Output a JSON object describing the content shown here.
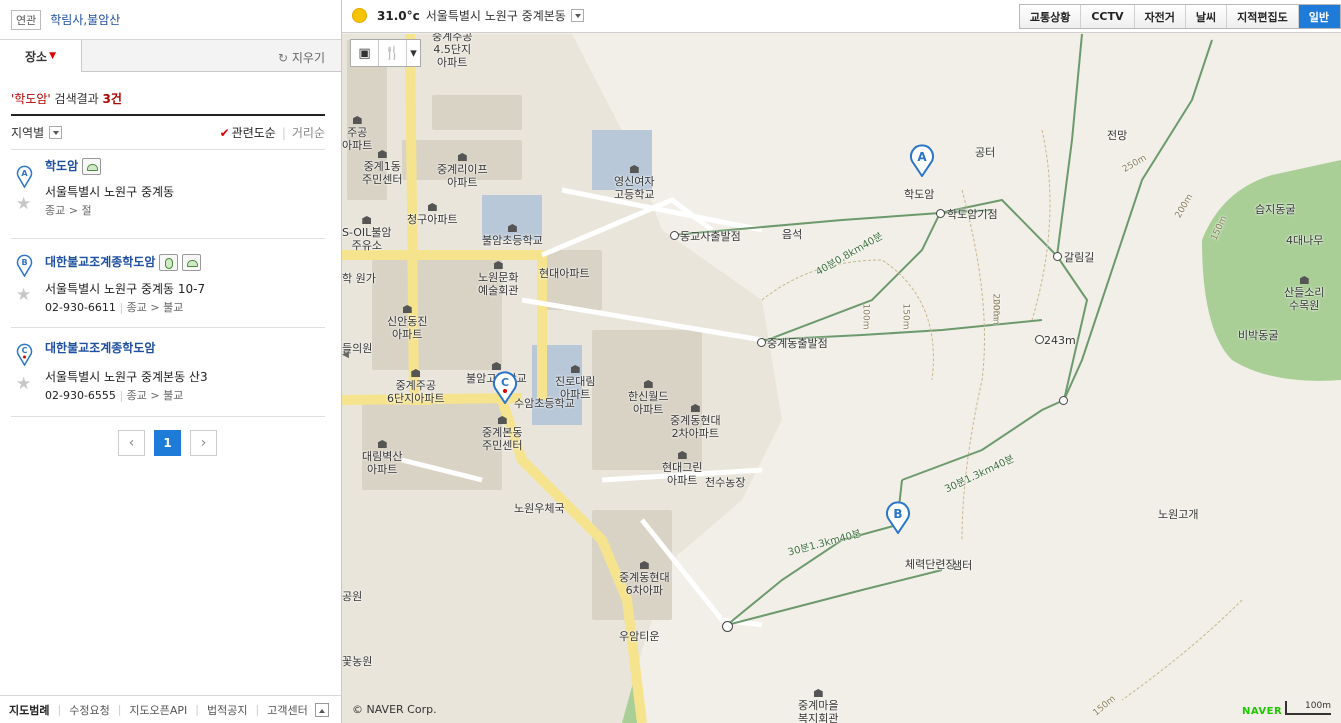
{
  "related": {
    "tag": "연관",
    "links": "학림사,불암산"
  },
  "tabs": {
    "place": "장소",
    "clear": "지우기"
  },
  "result": {
    "query": "'학도암'",
    "label": " 검색결과 ",
    "count": "3건"
  },
  "sort": {
    "region": "지역별",
    "relevance": "관련도순",
    "distance": "거리순"
  },
  "items": [
    {
      "marker": "A",
      "name_pre": "",
      "name_hl": "학도암",
      "address": "서울특별시 노원구 중계동",
      "phone": "",
      "category": "종교 > 절"
    },
    {
      "marker": "B",
      "name_pre": "대한불교조계종",
      "name_hl": "학도암",
      "address": "서울특별시 노원구 중계동 10-7",
      "phone": "02-930-6611",
      "category": "종교 > 불교"
    },
    {
      "marker": "C",
      "name_pre": "대한불교조계종",
      "name_hl": "학도암",
      "address": "서울특별시 노원구 중계본동 산3",
      "phone": "02-930-6555",
      "category": "종교 > 불교"
    }
  ],
  "pager": {
    "prev": "‹",
    "current": "1",
    "next": "›"
  },
  "footer": {
    "links": [
      "지도범례",
      "수정요청",
      "지도오픈API",
      "법적공지",
      "고객센터"
    ]
  },
  "weather": {
    "temp": "31.0°c",
    "location": "서울특별시 노원구 중계본동"
  },
  "layers": [
    "교통상황",
    "CCTV",
    "자전거",
    "날씨",
    "지적편집도",
    "일반"
  ],
  "map": {
    "copyright": "© NAVER Corp.",
    "brand": "NAVER",
    "scale": "100m",
    "labels": [
      {
        "id": "l1",
        "text": "중계주공\n4.5단지\n아파트"
      },
      {
        "id": "l2",
        "text": "주공\n아파트"
      },
      {
        "id": "l3",
        "text": "중계1동\n주민센터"
      },
      {
        "id": "l4",
        "text": "중계리이프\n아파트"
      },
      {
        "id": "l5",
        "text": "영신여자\n고등학교"
      },
      {
        "id": "l6",
        "text": "청구아파트"
      },
      {
        "id": "l7",
        "text": "S-OIL불암\n주유소"
      },
      {
        "id": "l8",
        "text": "불암초등학교"
      },
      {
        "id": "l9",
        "text": "동교사출발점"
      },
      {
        "id": "l10",
        "text": "음석"
      },
      {
        "id": "l11",
        "text": "현대아파트"
      },
      {
        "id": "l12",
        "text": "노원문화\n예술회관"
      },
      {
        "id": "l13",
        "text": "학 원가"
      },
      {
        "id": "l14",
        "text": "신안동진\n아파트"
      },
      {
        "id": "l15",
        "text": "들의원"
      },
      {
        "id": "l16",
        "text": "중계동출발점"
      },
      {
        "id": "l17",
        "text": "중계주공\n6단지아파트"
      },
      {
        "id": "l18",
        "text": "불암고등학교"
      },
      {
        "id": "l19",
        "text": "진로대림\n아파트"
      },
      {
        "id": "l20",
        "text": "한신월드\n아파트"
      },
      {
        "id": "l21",
        "text": "중계동현대\n2차아파트"
      },
      {
        "id": "l22",
        "text": "수암초등학교"
      },
      {
        "id": "l23",
        "text": "중계본동\n주민센터"
      },
      {
        "id": "l24",
        "text": "대림벽산\n아파트"
      },
      {
        "id": "l25",
        "text": "현대그린\n아파트"
      },
      {
        "id": "l26",
        "text": "천수농장"
      },
      {
        "id": "l27",
        "text": "노원우체국"
      },
      {
        "id": "l28",
        "text": "중계동현대\n6차아파"
      },
      {
        "id": "l29",
        "text": "우암티운"
      },
      {
        "id": "l30",
        "text": "꽃농원"
      },
      {
        "id": "l31",
        "text": "공원"
      },
      {
        "id": "l32",
        "text": "중계마을\n복지회관"
      },
      {
        "id": "l33",
        "text": "학도암"
      },
      {
        "id": "l34",
        "text": "학도암기점"
      },
      {
        "id": "l35",
        "text": "공터"
      },
      {
        "id": "l36",
        "text": "전망"
      },
      {
        "id": "l37",
        "text": "갈림길"
      },
      {
        "id": "l38",
        "text": "243m"
      },
      {
        "id": "l39",
        "text": "체력단련장"
      },
      {
        "id": "l40",
        "text": "샘터"
      },
      {
        "id": "l41",
        "text": "노원고개"
      },
      {
        "id": "l42",
        "text": "습지동굴"
      },
      {
        "id": "l43",
        "text": "4대나무"
      },
      {
        "id": "l44",
        "text": "산들소리\n수목원"
      },
      {
        "id": "l45",
        "text": "비박동굴"
      }
    ],
    "trails": [
      "40분0.8km40분",
      "30분1.3km40분",
      "30분1.3km40분"
    ],
    "contours": [
      "250m",
      "200m",
      "150m",
      "100m",
      "150m",
      "200m",
      "150m",
      "200m"
    ]
  }
}
